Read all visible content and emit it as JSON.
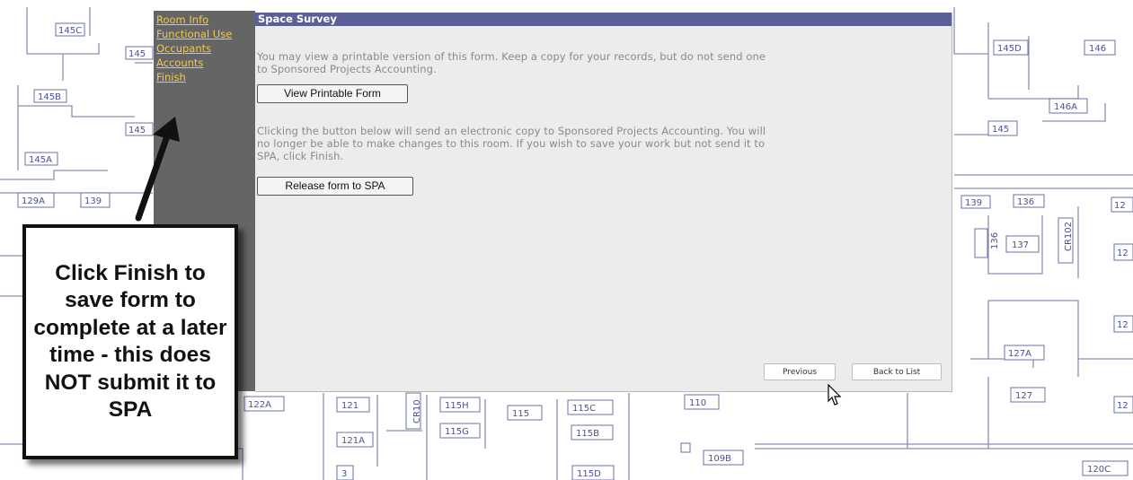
{
  "nav": {
    "items": [
      {
        "label": "Room Info"
      },
      {
        "label": "Functional Use"
      },
      {
        "label": "Occupants"
      },
      {
        "label": "Accounts"
      },
      {
        "label": "Finish"
      }
    ],
    "link_color": "#f2c94c",
    "panel_color": "#656565"
  },
  "form": {
    "title": "Space Survey",
    "title_bar_color": "#5a5f98",
    "print_text_line1": "You may view a printable version of this form. Keep a copy for your records, but do not send one",
    "print_text_line2": "to Sponsored Projects Accounting.",
    "view_printable_label": "View Printable Form",
    "release_text_line1": "Clicking the button below will send an electronic copy to Sponsored Projects Accounting. You will",
    "release_text_line2": "no longer be able to make changes to this room. If you wish to save your work but not send it to",
    "release_text_line3": "SPA, click Finish.",
    "release_label": "Release form to SPA",
    "previous_label": "Previous",
    "back_label": "Back to List"
  },
  "annotation": {
    "callout_text": "Click Finish to save form to complete at a later time - this does NOT submit it to SPA"
  },
  "floorplan": {
    "room_labels": [
      "145C",
      "145",
      "145B",
      "145",
      "145A",
      "129A",
      "139",
      "145D",
      "146",
      "146A",
      "145",
      "139",
      "136",
      "12",
      "136",
      "137",
      "CR102",
      "12",
      "12",
      "127A",
      "127",
      "12",
      "122A",
      "121",
      "CR10",
      "115H",
      "115",
      "115C",
      "110",
      "121A",
      "115G",
      "115B",
      "109B",
      "120C",
      "115D",
      "3"
    ]
  },
  "icons": {
    "cursor": "mouse-pointer-icon",
    "arrow": "annotation-arrow-icon"
  }
}
